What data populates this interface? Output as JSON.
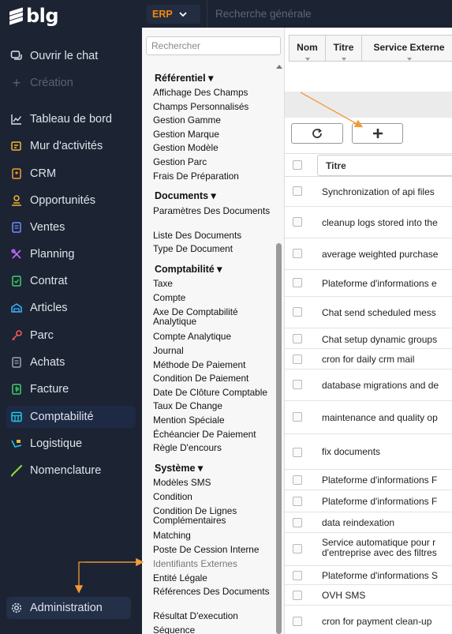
{
  "app": {
    "logo_text": "blg"
  },
  "sidebar": {
    "items": [
      {
        "label": "Ouvrir le chat"
      },
      {
        "label": "Création"
      },
      {
        "label": "Tableau de bord"
      },
      {
        "label": "Mur d'activités"
      },
      {
        "label": "CRM"
      },
      {
        "label": "Opportunités"
      },
      {
        "label": "Ventes"
      },
      {
        "label": "Planning"
      },
      {
        "label": "Contrat"
      },
      {
        "label": "Articles"
      },
      {
        "label": "Parc"
      },
      {
        "label": "Achats"
      },
      {
        "label": "Facture"
      },
      {
        "label": "Comptabilité"
      },
      {
        "label": "Logistique"
      },
      {
        "label": "Nomenclature"
      },
      {
        "label": "Administration"
      }
    ],
    "active_item": "Comptabilité"
  },
  "topbar": {
    "module": "ERP",
    "search_placeholder": "Recherche générale"
  },
  "menu": {
    "search_placeholder": "Rechercher",
    "sections": [
      {
        "title": "Référentiel ▾",
        "links": [
          "Affichage Des Champs",
          "Champs Personnalisés",
          "Gestion Gamme",
          "Gestion Marque",
          "Gestion Modèle",
          "Gestion Parc",
          "Frais De Préparation"
        ]
      },
      {
        "title": "Documents ▾",
        "links": [
          "Paramètres Des Documents",
          "Liste Des Documents",
          "Type De Document"
        ]
      },
      {
        "title": "Comptabilité ▾",
        "links": [
          "Taxe",
          "Compte",
          "Axe De Comptabilité Analytique",
          "Compte Analytique",
          "Journal",
          "Méthode De Paiement",
          "Condition De Paiement",
          "Date De Clôture Comptable",
          "Taux De Change",
          "Mention Spéciale",
          "Échéancier De Paiement",
          "Règle D'encours"
        ]
      },
      {
        "title": "Système ▾",
        "links": [
          "Modèles SMS",
          "Condition",
          "Condition De Lignes Complémentaires",
          "Matching",
          "Poste De Cession Interne",
          "Identifiants Externes",
          "Entité Légale",
          "Références Des Documents",
          "Résultat D'execution",
          "Séquence"
        ]
      }
    ]
  },
  "table": {
    "column_headers": [
      "Nom",
      "Titre",
      "Service Externe"
    ],
    "title_filter": "Titre",
    "refresh_icon": "refresh-icon",
    "add_icon": "plus-icon",
    "rows": [
      "Synchronization of api files",
      "cleanup logs stored into the",
      "average weighted purchase",
      "Plateforme d'informations e",
      "Chat send scheduled mess",
      "Chat setup dynamic groups",
      "cron for daily crm mail",
      "database migrations and de",
      "maintenance and quality op",
      "fix documents",
      "Plateforme d'informations F",
      "Plateforme d'informations F",
      "data reindexation",
      "Service automatique pour r",
      "d'entreprise avec des filtres",
      "Plateforme d'informations S",
      "OVH SMS",
      "cron for payment clean-up"
    ]
  },
  "colors": {
    "sidebar_bg": "#1c2333",
    "accent_orange": "#f58a07",
    "annotation_arrow": "#f29a38"
  }
}
